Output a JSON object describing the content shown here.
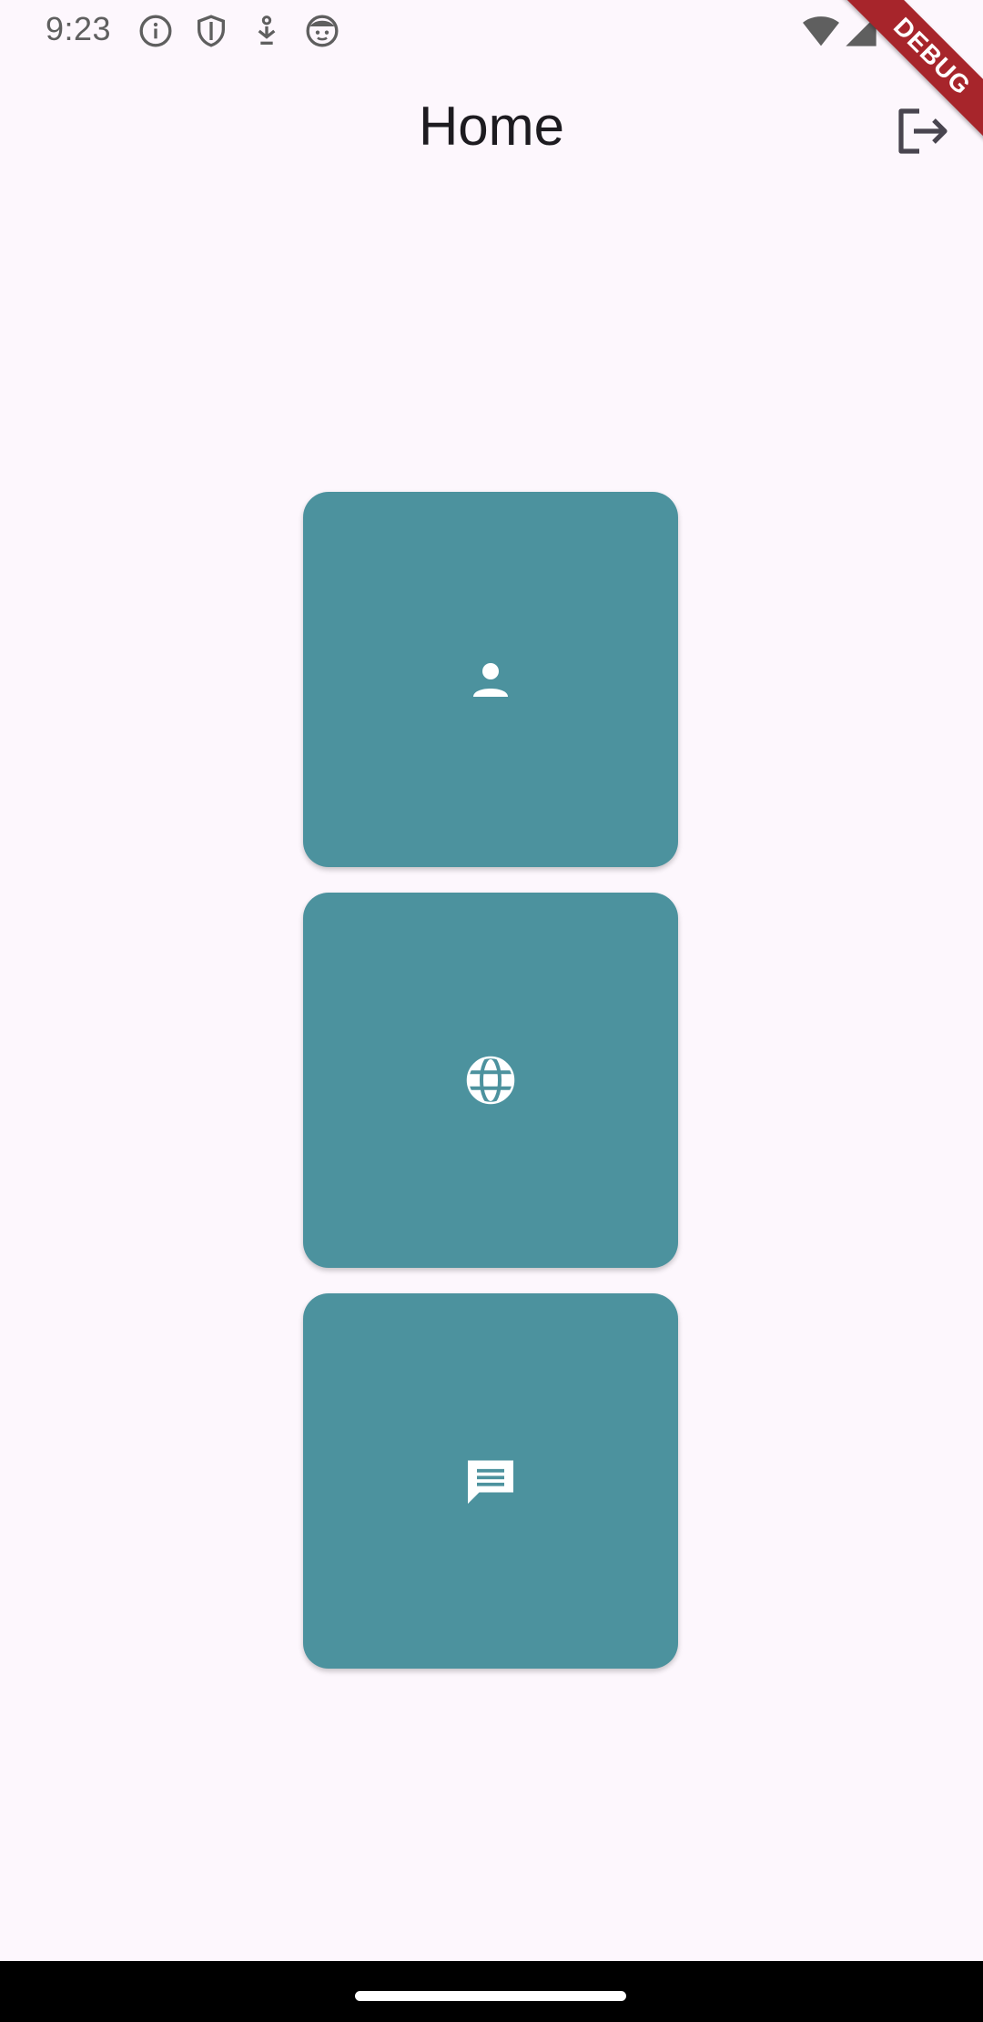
{
  "status_bar": {
    "time": "9:23",
    "icons": [
      "info-icon",
      "shield-icon",
      "download-icon",
      "face-icon"
    ],
    "right_icons": [
      "wifi-icon",
      "signal-icon"
    ]
  },
  "debug_banner": "DEBUG",
  "app_bar": {
    "title": "Home",
    "action_icon": "logout-icon"
  },
  "tiles": [
    {
      "icon": "person-icon"
    },
    {
      "icon": "globe-icon"
    },
    {
      "icon": "chat-icon"
    }
  ],
  "colors": {
    "background": "#FDF7FD",
    "tile": "#4C929E",
    "debug": "#A7252B"
  }
}
